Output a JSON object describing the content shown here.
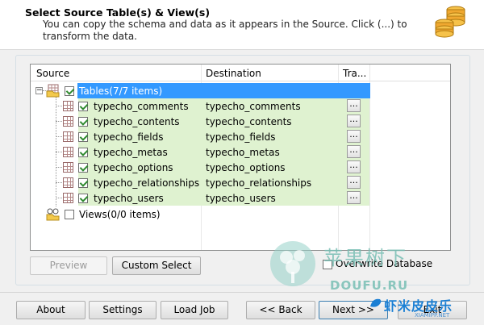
{
  "header": {
    "title": "Select Source Table(s) & View(s)",
    "description": "You can copy the schema and data as it appears in the Source. Click (...) to transform the data."
  },
  "grid": {
    "columns": [
      "Source",
      "Destination",
      "Tra..."
    ],
    "tables_group": {
      "label": "Tables(7/7 items)",
      "checked": true
    },
    "rows": [
      {
        "source": "typecho_comments",
        "destination": "typecho_comments",
        "button": "..."
      },
      {
        "source": "typecho_contents",
        "destination": "typecho_contents",
        "button": "..."
      },
      {
        "source": "typecho_fields",
        "destination": "typecho_fields",
        "button": "..."
      },
      {
        "source": "typecho_metas",
        "destination": "typecho_metas",
        "button": "..."
      },
      {
        "source": "typecho_options",
        "destination": "typecho_options",
        "button": "..."
      },
      {
        "source": "typecho_relationships",
        "destination": "typecho_relationships",
        "button": "..."
      },
      {
        "source": "typecho_users",
        "destination": "typecho_users",
        "button": "..."
      }
    ],
    "views_group": {
      "label": "Views(0/0 items)",
      "checked": false
    }
  },
  "actions": {
    "preview": "Preview",
    "custom_select": "Custom Select",
    "overwrite_label": "Overwrite Database"
  },
  "footer": {
    "about": "About",
    "settings": "Settings",
    "load_job": "Load Job",
    "back": "<< Back",
    "next": "Next >>",
    "exit": "Exit"
  },
  "watermark": {
    "cn_text": "苹果树下",
    "en_text": "DOUFU.RU",
    "cn_text2": "虾米皮皮乐",
    "small_text": "XIAMIPP.NET"
  },
  "colors": {
    "row_highlight": "#dff2d0",
    "selection": "#3399ff",
    "check": "#2f8a2f"
  }
}
